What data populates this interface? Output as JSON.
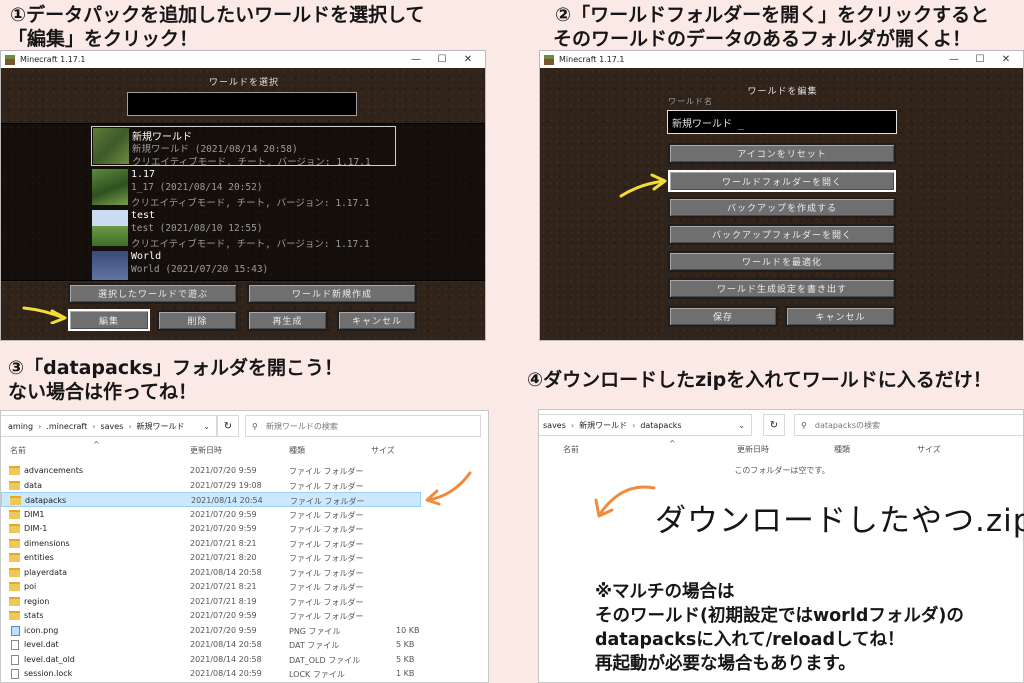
{
  "headings": {
    "step1_line1": "①データパックを追加したいワールドを選択して",
    "step1_line2": "「編集」をクリック！",
    "step2_line1": "②「ワールドフォルダーを開く」をクリックすると",
    "step2_line2": "そのワールドのデータのあるフォルダが開くよ！",
    "step3_line1": "③「datapacks」フォルダを開こう！",
    "step3_line2": "ない場合は作ってね！",
    "step4_line1": "④ダウンロードしたzipを入れてワールドに入るだけ！"
  },
  "window_title": "Minecraft 1.17.1",
  "window_controls": [
    "—",
    "☐",
    "✕"
  ],
  "select_world": {
    "title": "ワールドを選択",
    "search_value": "",
    "worlds": [
      {
        "name": "新規ワールド",
        "detail": "新規ワールド (2021/08/14 20:58)",
        "mode": "クリエイティブモード, チート, バージョン: 1.17.1"
      },
      {
        "name": "1.17",
        "detail": "1_17 (2021/08/14 20:52)",
        "mode": "クリエイティブモード, チート, バージョン: 1.17.1"
      },
      {
        "name": "test",
        "detail": "test (2021/08/10 12:55)",
        "mode": "クリエイティブモード, チート, バージョン: 1.17.1"
      },
      {
        "name": "World",
        "detail": "World (2021/07/20 15:43)",
        "mode": ""
      }
    ],
    "buttons": {
      "play": "選択したワールドで遊ぶ",
      "create": "ワールド新規作成",
      "edit": "編集",
      "delete": "削除",
      "recreate": "再生成",
      "cancel": "キャンセル"
    }
  },
  "edit_world": {
    "title": "ワールドを編集",
    "name_label": "ワールド名",
    "name_value": "新規ワールド _",
    "buttons": {
      "reset_icon": "アイコンをリセット",
      "open_folder": "ワールドフォルダーを開く",
      "make_backup": "バックアップを作成する",
      "open_backups": "バックアップフォルダーを開く",
      "optimize": "ワールドを最適化",
      "export_settings": "ワールド生成設定を書き出す",
      "save": "保存",
      "cancel": "キャンセル"
    }
  },
  "explorer1": {
    "path": [
      "aming",
      ".minecraft",
      "saves",
      "新規ワールド"
    ],
    "search_placeholder": "新規ワールドの検索",
    "columns": [
      "名前",
      "更新日時",
      "種類",
      "サイズ"
    ],
    "rows": [
      {
        "name": "advancements",
        "date": "2021/07/20 9:59",
        "type": "ファイル フォルダー",
        "size": "",
        "icon": "folder"
      },
      {
        "name": "data",
        "date": "2021/07/29 19:08",
        "type": "ファイル フォルダー",
        "size": "",
        "icon": "folder"
      },
      {
        "name": "datapacks",
        "date": "2021/08/14 20:54",
        "type": "ファイル フォルダー",
        "size": "",
        "icon": "folder"
      },
      {
        "name": "DIM1",
        "date": "2021/07/20 9:59",
        "type": "ファイル フォルダー",
        "size": "",
        "icon": "folder"
      },
      {
        "name": "DIM-1",
        "date": "2021/07/20 9:59",
        "type": "ファイル フォルダー",
        "size": "",
        "icon": "folder"
      },
      {
        "name": "dimensions",
        "date": "2021/07/21 8:21",
        "type": "ファイル フォルダー",
        "size": "",
        "icon": "folder"
      },
      {
        "name": "entities",
        "date": "2021/07/21 8:20",
        "type": "ファイル フォルダー",
        "size": "",
        "icon": "folder"
      },
      {
        "name": "playerdata",
        "date": "2021/08/14 20:58",
        "type": "ファイル フォルダー",
        "size": "",
        "icon": "folder"
      },
      {
        "name": "poi",
        "date": "2021/07/21 8:21",
        "type": "ファイル フォルダー",
        "size": "",
        "icon": "folder"
      },
      {
        "name": "region",
        "date": "2021/07/21 8:19",
        "type": "ファイル フォルダー",
        "size": "",
        "icon": "folder"
      },
      {
        "name": "stats",
        "date": "2021/07/20 9:59",
        "type": "ファイル フォルダー",
        "size": "",
        "icon": "folder"
      },
      {
        "name": "icon.png",
        "date": "2021/07/20 9:59",
        "type": "PNG ファイル",
        "size": "10 KB",
        "icon": "png"
      },
      {
        "name": "level.dat",
        "date": "2021/08/14 20:58",
        "type": "DAT ファイル",
        "size": "5 KB",
        "icon": "file"
      },
      {
        "name": "level.dat_old",
        "date": "2021/08/14 20:58",
        "type": "DAT_OLD ファイル",
        "size": "5 KB",
        "icon": "file"
      },
      {
        "name": "session.lock",
        "date": "2021/08/14 20:59",
        "type": "LOCK ファイル",
        "size": "1 KB",
        "icon": "file"
      }
    ]
  },
  "explorer2": {
    "path": [
      "saves",
      "新規ワールド",
      "datapacks"
    ],
    "search_placeholder": "datapacksの検索",
    "columns": [
      "名前",
      "更新日時",
      "種類",
      "サイズ"
    ],
    "empty_message": "このフォルダーは空です。",
    "handwritten": "ダウンロードしたやつ.zip"
  },
  "note": {
    "line1": "※マルチの場合は",
    "line2": "そのワールド(初期設定ではworldフォルダ)の",
    "line3": "datapacksに入れて/reloadしてね！",
    "line4": "再起動が必要な場合もあります。"
  },
  "colors": {
    "background": "#fbe9e5",
    "arrow_yellow": "#f2dc3a",
    "arrow_orange": "#f08a3c",
    "selection_blue": "#cce8ff"
  }
}
